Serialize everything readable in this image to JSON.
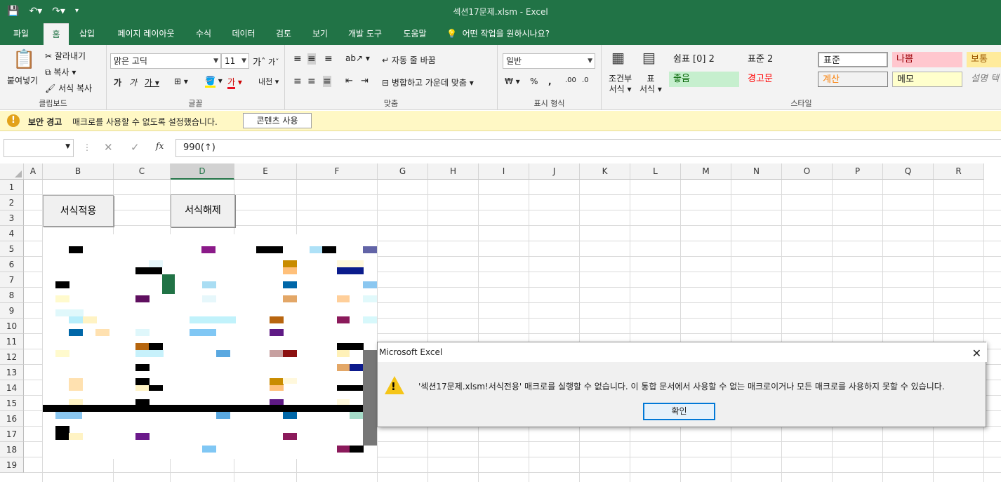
{
  "window": {
    "title": "섹션17문제.xlsm  -  Excel"
  },
  "qat": {
    "save_icon": "save-icon",
    "undo_icon": "undo-icon",
    "redo_icon": "redo-icon"
  },
  "tabs": [
    "파일",
    "홈",
    "삽입",
    "페이지 레이아웃",
    "수식",
    "데이터",
    "검토",
    "보기",
    "개발 도구",
    "도움말"
  ],
  "tell_me": "어떤 작업을 원하시나요?",
  "ribbon": {
    "clipboard": {
      "paste": "붙여넣기",
      "cut": "잘라내기",
      "copy": "복사",
      "format_painter": "서식 복사",
      "label": "클립보드"
    },
    "font": {
      "name": "맑은 고딕",
      "size": "11",
      "label": "글꼴"
    },
    "alignment": {
      "wrap": "자동 줄 바꿈",
      "merge": "병합하고 가운데 맞춤",
      "label": "맞춤"
    },
    "number": {
      "format": "일반",
      "label": "표시 형식"
    },
    "styles": {
      "conditional": [
        "조건부",
        "서식"
      ],
      "table": [
        "표",
        "서식"
      ],
      "label": "스타일",
      "cells": [
        "쉼표 [0] 2",
        "표준 2",
        "표준",
        "나쁨",
        "보통",
        "좋음",
        "경고문",
        "계산",
        "메모",
        "설명 텍"
      ]
    }
  },
  "message_bar": {
    "title": "보안 경고",
    "text": "매크로를 사용할 수 없도록 설정했습니다.",
    "button": "콘텐츠 사용"
  },
  "formula_bar": {
    "value": "990(↑)",
    "fx": "fx"
  },
  "columns": [
    "A",
    "B",
    "C",
    "D",
    "E",
    "F",
    "G",
    "H",
    "I",
    "J",
    "K",
    "L",
    "M",
    "N",
    "O",
    "P",
    "Q",
    "R"
  ],
  "rows": [
    "1",
    "2",
    "3",
    "4",
    "5",
    "6",
    "7",
    "8",
    "9",
    "10",
    "11",
    "12",
    "13",
    "14",
    "15",
    "16",
    "17",
    "18",
    "19"
  ],
  "shapes": {
    "apply": "서식적용",
    "remove": "서식해제"
  },
  "dialog": {
    "title": "Microsoft Excel",
    "message": "'섹션17문제.xlsm!서식전용' 매크로를 실행할 수 없습니다. 이 통합 문서에서 사용할 수 없는 매크로이거나 모든 매크로를 사용하지 못할 수 있습니다.",
    "ok": "확인"
  }
}
